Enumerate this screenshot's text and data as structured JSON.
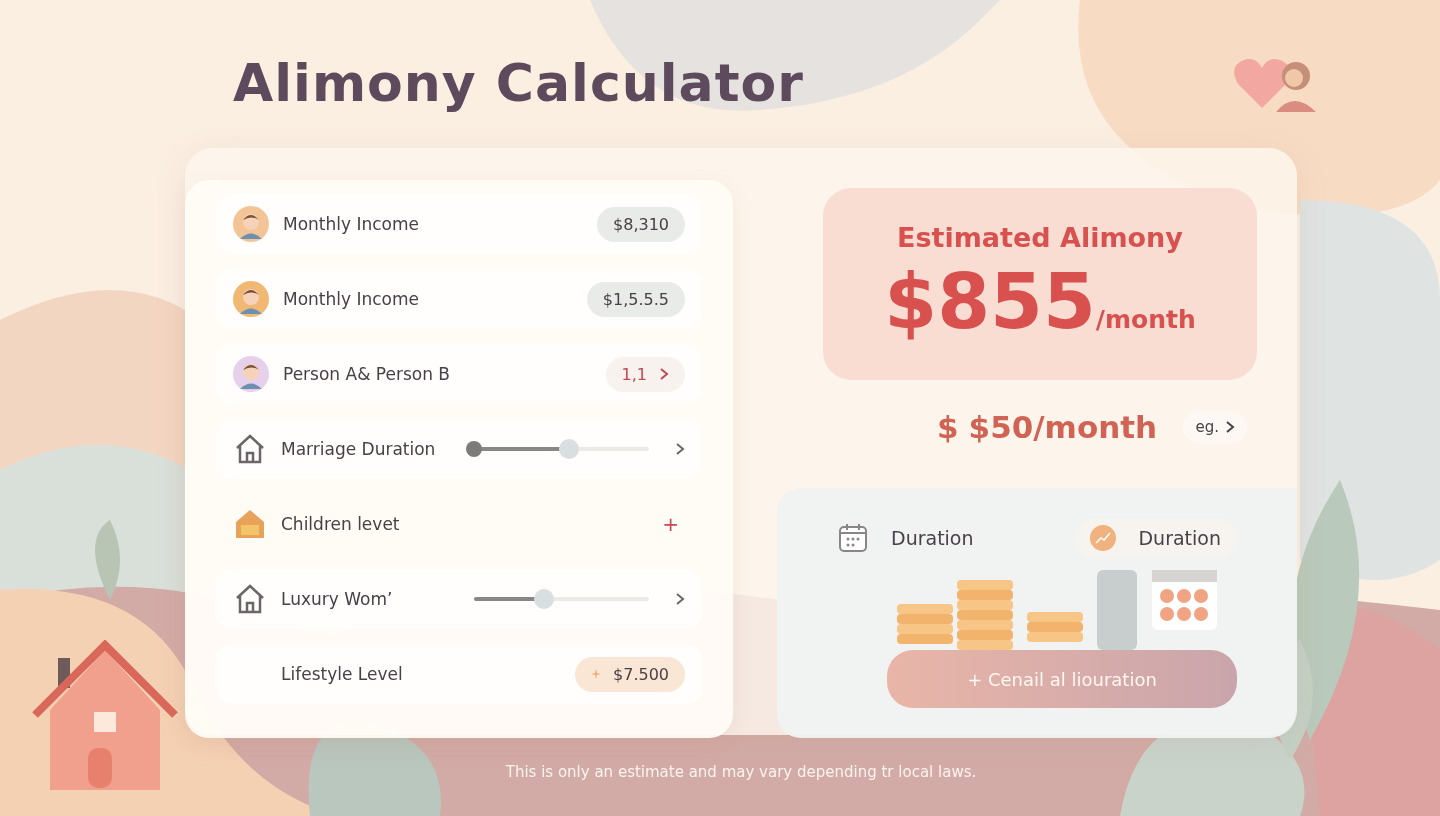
{
  "title": "Alimony Calculator",
  "inputs": [
    {
      "kind": "value",
      "label": "Monthly Income",
      "value": "$8,310"
    },
    {
      "kind": "value",
      "label": "Monthly Income",
      "value": "$1,5.5.5"
    },
    {
      "kind": "stepper",
      "label": "Person A& Person B",
      "value": "1,1"
    },
    {
      "kind": "slider",
      "label": "Marriage Duration",
      "level": 0.54
    },
    {
      "kind": "add",
      "label": "Children levet",
      "value": "+"
    },
    {
      "kind": "slider",
      "label": "Luxury Wom’",
      "level": 0.4
    },
    {
      "kind": "accent",
      "label": "Lifestyle Level",
      "value": "$7.500"
    }
  ],
  "result": {
    "heading": "Estimated Alimony",
    "amount": "$855",
    "unit": "/month"
  },
  "alternative": {
    "prefix": "$",
    "amount": "$50/month",
    "link": "eg."
  },
  "details": {
    "items": [
      {
        "label": "Duration"
      },
      {
        "label": "Duration"
      }
    ],
    "button": "+ Cenail al liouration"
  },
  "footnote": "This is only an estimate and may vary depending tr local laws."
}
